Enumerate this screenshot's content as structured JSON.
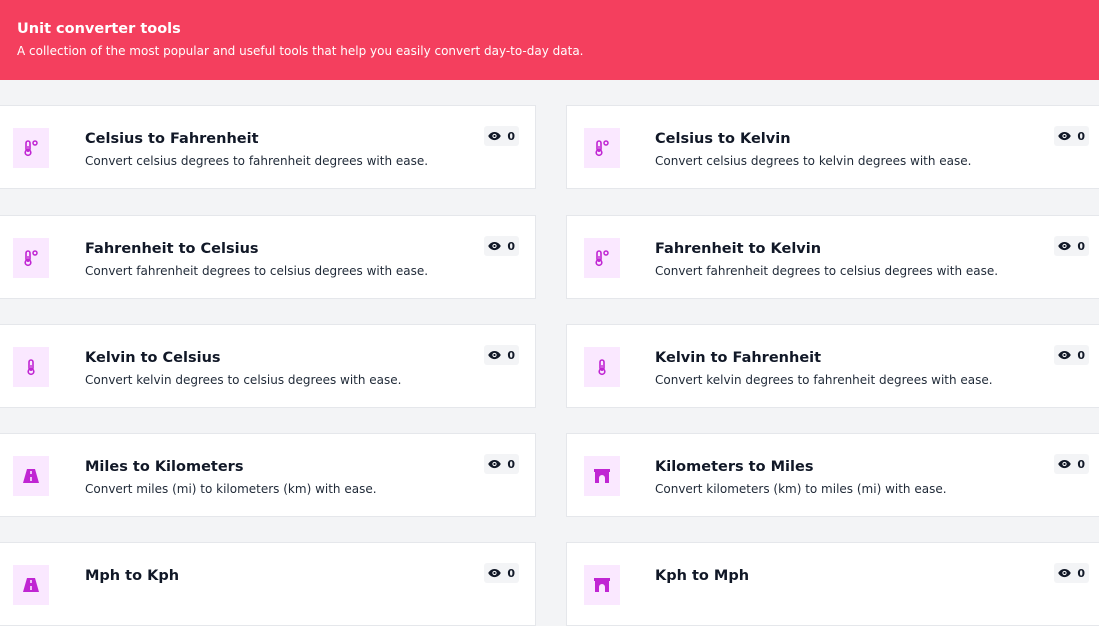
{
  "header": {
    "title": "Unit converter tools",
    "subtitle": "A collection of the most popular and useful tools that help you easily convert day-to-day data."
  },
  "colors": {
    "header_bg": "#f43f5e",
    "icon_color": "#c026d3",
    "icon_bg": "#fae8ff",
    "page_bg": "#f3f4f6"
  },
  "tools": [
    {
      "title": "Celsius to Fahrenheit",
      "description": "Convert celsius degrees to fahrenheit degrees with ease.",
      "views": "0",
      "icon": "thermometer-degree-icon"
    },
    {
      "title": "Celsius to Kelvin",
      "description": "Convert celsius degrees to kelvin degrees with ease.",
      "views": "0",
      "icon": "thermometer-degree-icon"
    },
    {
      "title": "Fahrenheit to Celsius",
      "description": "Convert fahrenheit degrees to celsius degrees with ease.",
      "views": "0",
      "icon": "thermometer-degree-icon"
    },
    {
      "title": "Fahrenheit to Kelvin",
      "description": "Convert fahrenheit degrees to celsius degrees with ease.",
      "views": "0",
      "icon": "thermometer-degree-icon"
    },
    {
      "title": "Kelvin to Celsius",
      "description": "Convert kelvin degrees to celsius degrees with ease.",
      "views": "0",
      "icon": "thermometer-icon"
    },
    {
      "title": "Kelvin to Fahrenheit",
      "description": "Convert kelvin degrees to fahrenheit degrees with ease.",
      "views": "0",
      "icon": "thermometer-icon"
    },
    {
      "title": "Miles to Kilometers",
      "description": "Convert miles (mi) to kilometers (km) with ease.",
      "views": "0",
      "icon": "road-icon"
    },
    {
      "title": "Kilometers to Miles",
      "description": "Convert kilometers (km) to miles (mi) with ease.",
      "views": "0",
      "icon": "archway-icon"
    },
    {
      "title": "Mph to Kph",
      "description": "",
      "views": "0",
      "icon": "road-icon"
    },
    {
      "title": "Kph to Mph",
      "description": "",
      "views": "0",
      "icon": "archway-icon"
    }
  ]
}
